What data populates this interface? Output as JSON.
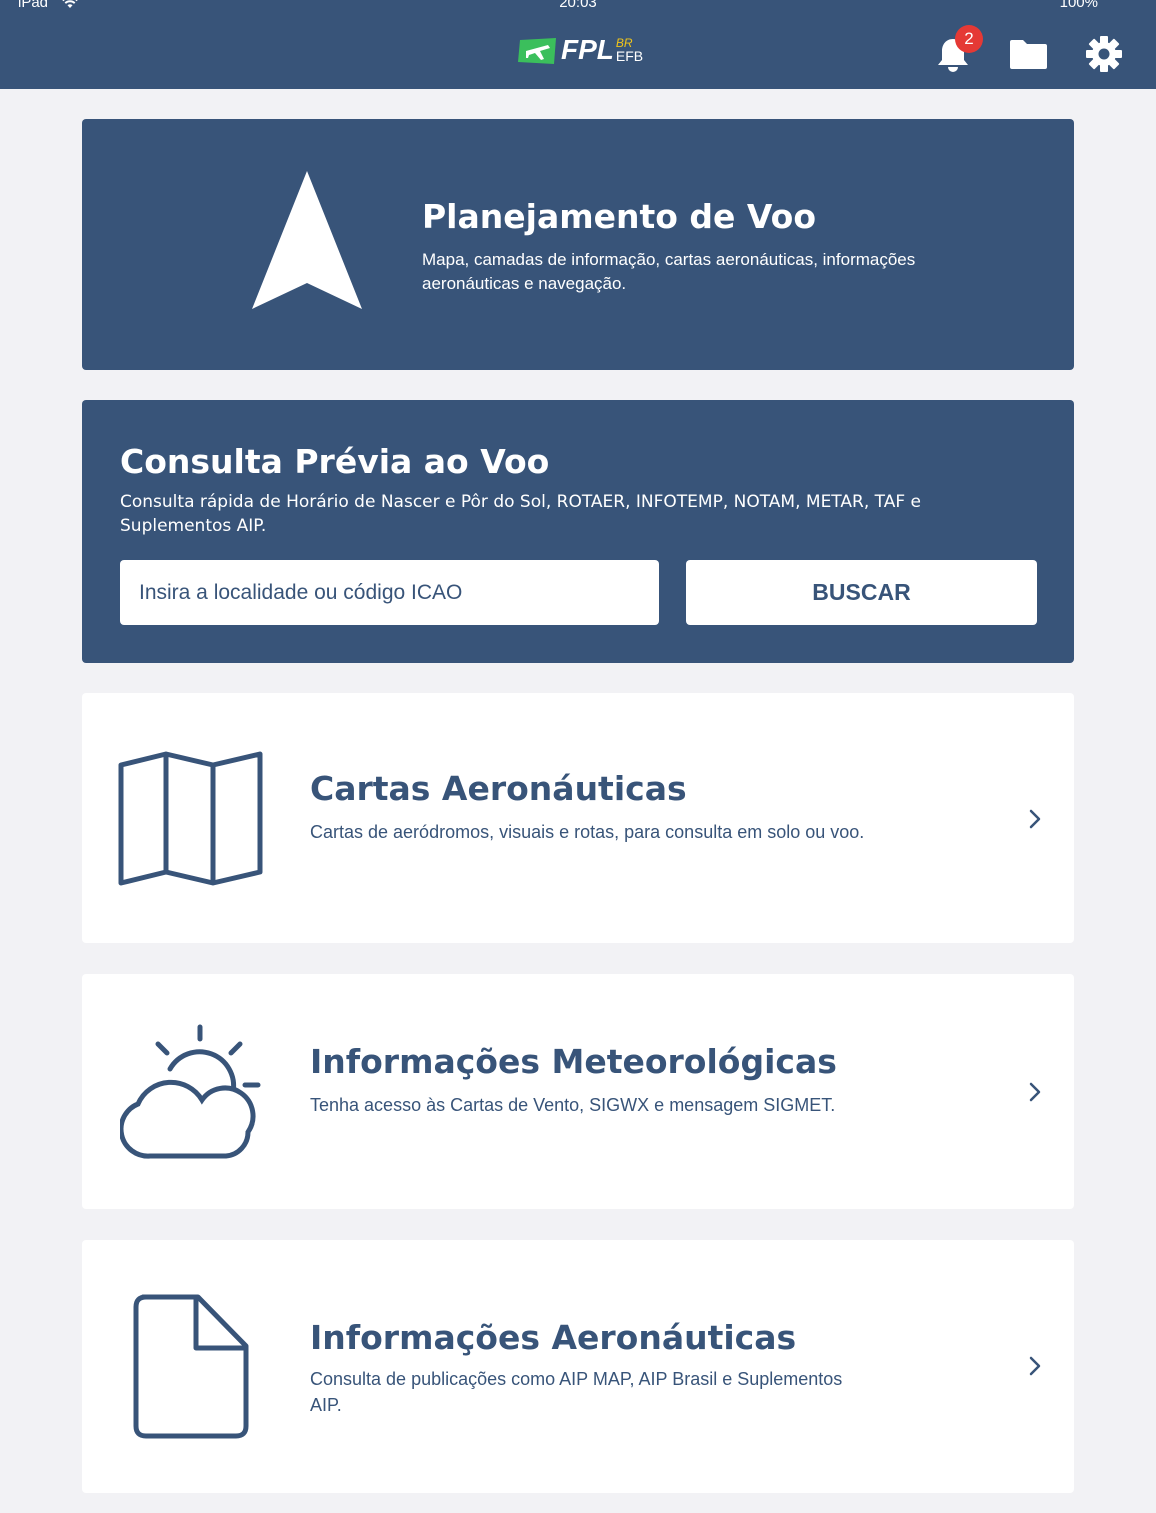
{
  "status_bar": {
    "device": "iPad",
    "time": "20:03",
    "battery": "100%"
  },
  "header": {
    "logo_text": "FPL",
    "logo_br": "BR",
    "logo_efb": "EFB",
    "notification_count": "2",
    "icons": [
      "bell-icon",
      "folder-icon",
      "gear-icon"
    ]
  },
  "planejamento": {
    "title": "Planejamento de Voo",
    "description": "Mapa, camadas de informação, cartas aeronáuticas, informações aeronáuticas e navegação."
  },
  "consulta": {
    "title": "Consulta Prévia ao Voo",
    "description": "Consulta rápida de Horário de Nascer e Pôr do Sol, ROTAER, INFOTEMP, NOTAM, METAR, TAF e Suplementos AIP.",
    "input_placeholder": "Insira a localidade ou código ICAO",
    "input_value": "",
    "button_label": "BUSCAR"
  },
  "menu": [
    {
      "title": "Cartas Aeronáuticas",
      "description": "Cartas de aeródromos, visuais e rotas, para consulta em solo ou voo.",
      "icon": "map-icon"
    },
    {
      "title": "Informações Meteorológicas",
      "description": "Tenha acesso às Cartas de Vento, SIGWX e mensagem SIGMET.",
      "icon": "weather-icon"
    },
    {
      "title": "Informações Aeronáuticas",
      "description": "Consulta de publicações como AIP MAP, AIP Brasil e Suplementos AIP.",
      "icon": "document-icon"
    }
  ],
  "colors": {
    "primary": "#385479",
    "background": "#f2f2f5",
    "badge": "#e53935",
    "logo_green": "#3bbf5c",
    "logo_yellow": "#f0c419"
  }
}
